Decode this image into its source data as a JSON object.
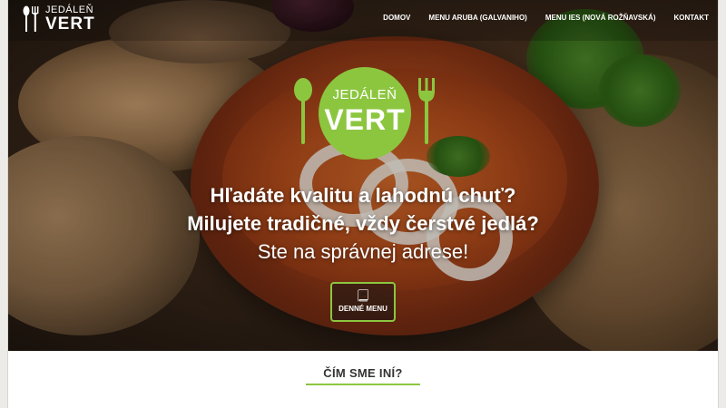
{
  "brand": {
    "name_small": "JEDÁLEŇ",
    "name_big": "VERT",
    "accent_color": "#8cc63f"
  },
  "nav": {
    "items": [
      {
        "label": "DOMOV"
      },
      {
        "label": "MENU ARUBA (GALVANIHO)"
      },
      {
        "label": "MENU IES (NOVÁ ROŽŇAVSKÁ)"
      },
      {
        "label": "KONTAKT"
      }
    ]
  },
  "hero": {
    "line1": "Hľadáte kvalitu a lahodnú chuť?",
    "line2": "Milujete tradičné, vždy čerstvé jedlá?",
    "line3": "Ste na správnej adrese!",
    "cta_label": "DENNÉ MENU",
    "cta_icon": "book-icon"
  },
  "section": {
    "title": "ČÍM SME INÍ?"
  }
}
